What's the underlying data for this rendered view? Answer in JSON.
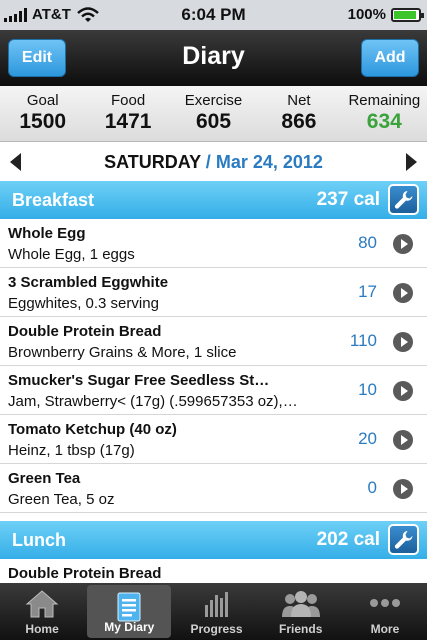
{
  "status": {
    "carrier": "AT&T",
    "time": "6:04 PM",
    "battery": "100%"
  },
  "nav": {
    "edit_label": "Edit",
    "title": "Diary",
    "add_label": "Add"
  },
  "summary": [
    {
      "label": "Goal",
      "value": "1500"
    },
    {
      "label": "Food",
      "value": "1471"
    },
    {
      "label": "Exercise",
      "value": "605"
    },
    {
      "label": "Net",
      "value": "866"
    },
    {
      "label": "Remaining",
      "value": "634"
    }
  ],
  "date": {
    "day": "SATURDAY",
    "separator": "/",
    "date": "Mar 24, 2012"
  },
  "breakfast": {
    "title": "Breakfast",
    "calories": "237 cal",
    "items": [
      {
        "name": "Whole Egg",
        "desc": "Whole Egg, 1 eggs",
        "cal": "80"
      },
      {
        "name": "3 Scrambled Eggwhite",
        "desc": "Eggwhites, 0.3 serving",
        "cal": "17"
      },
      {
        "name": "Double Protein Bread",
        "desc": "Brownberry Grains & More, 1 slice",
        "cal": "110"
      },
      {
        "name": "Smucker's Sugar Free Seedless St…",
        "desc": "Jam, Strawberry< (17g) (.599657353 oz),…",
        "cal": "10"
      },
      {
        "name": "Tomato Ketchup (40 oz)",
        "desc": "Heinz, 1 tbsp (17g)",
        "cal": "20"
      },
      {
        "name": "Green Tea",
        "desc": "Green Tea, 5 oz",
        "cal": "0"
      }
    ]
  },
  "lunch": {
    "title": "Lunch",
    "calories": "202 cal",
    "items": [
      {
        "name": "Double Protein Bread"
      }
    ]
  },
  "tabs": [
    {
      "label": "Home",
      "icon": "home-icon"
    },
    {
      "label": "My Diary",
      "icon": "diary-icon"
    },
    {
      "label": "Progress",
      "icon": "progress-icon"
    },
    {
      "label": "Friends",
      "icon": "friends-icon"
    },
    {
      "label": "More",
      "icon": "more-icon"
    }
  ],
  "colors": {
    "accent": "#34aee8",
    "link": "#2a7bc1",
    "remaining": "#3aa33b",
    "nav_button": "#2d97dd"
  }
}
